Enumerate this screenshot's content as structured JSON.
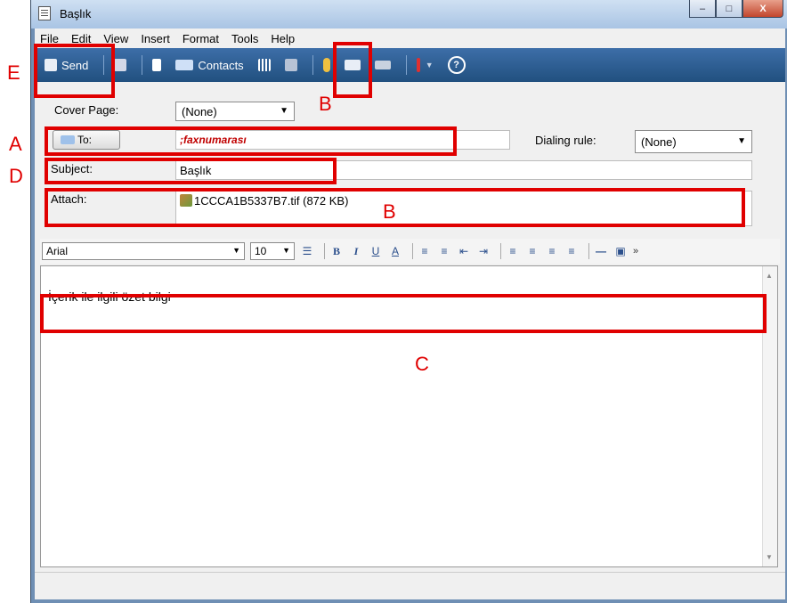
{
  "window": {
    "title": "Başlık",
    "minimize_glyph": "–",
    "maximize_glyph": "□",
    "close_glyph": "X"
  },
  "menu": [
    "File",
    "Edit",
    "View",
    "Insert",
    "Format",
    "Tools",
    "Help"
  ],
  "toolbar": {
    "send_label": "Send",
    "contacts_label": "Contacts",
    "icons": [
      "send-icon",
      "save-icon",
      "cover-page-icon",
      "contacts-icon",
      "address-book-grid-icon",
      "check-names-icon",
      "attach-icon",
      "scan-icon",
      "fax-icon",
      "priority-icon",
      "help-icon"
    ],
    "help_glyph": "?"
  },
  "fields": {
    "cover_page_label": "Cover Page:",
    "cover_page_value": "(None)",
    "to_button_label": "To:",
    "to_value": ";faxnumarası",
    "dialing_rule_label": "Dialing rule:",
    "dialing_rule_value": "(None)",
    "subject_label": "Subject:",
    "subject_value": "Başlık",
    "attach_label": "Attach:",
    "attachment_name": "1CCCA1B5337B7.tif (872 KB)"
  },
  "format_bar": {
    "font": "Arial",
    "size": "10",
    "bold": "B",
    "italic": "I",
    "underline": "U",
    "font_color": "A",
    "more": "»"
  },
  "body": {
    "text": "İçerik ile ilgili özet bilgi"
  },
  "annotations": {
    "A": "A",
    "B1": "B",
    "B2": "B",
    "C": "C",
    "D": "D",
    "E": "E"
  },
  "colors": {
    "annotation": "#e00000",
    "toolbar": "#2c5c94",
    "accent_red_text": "#c00000"
  }
}
